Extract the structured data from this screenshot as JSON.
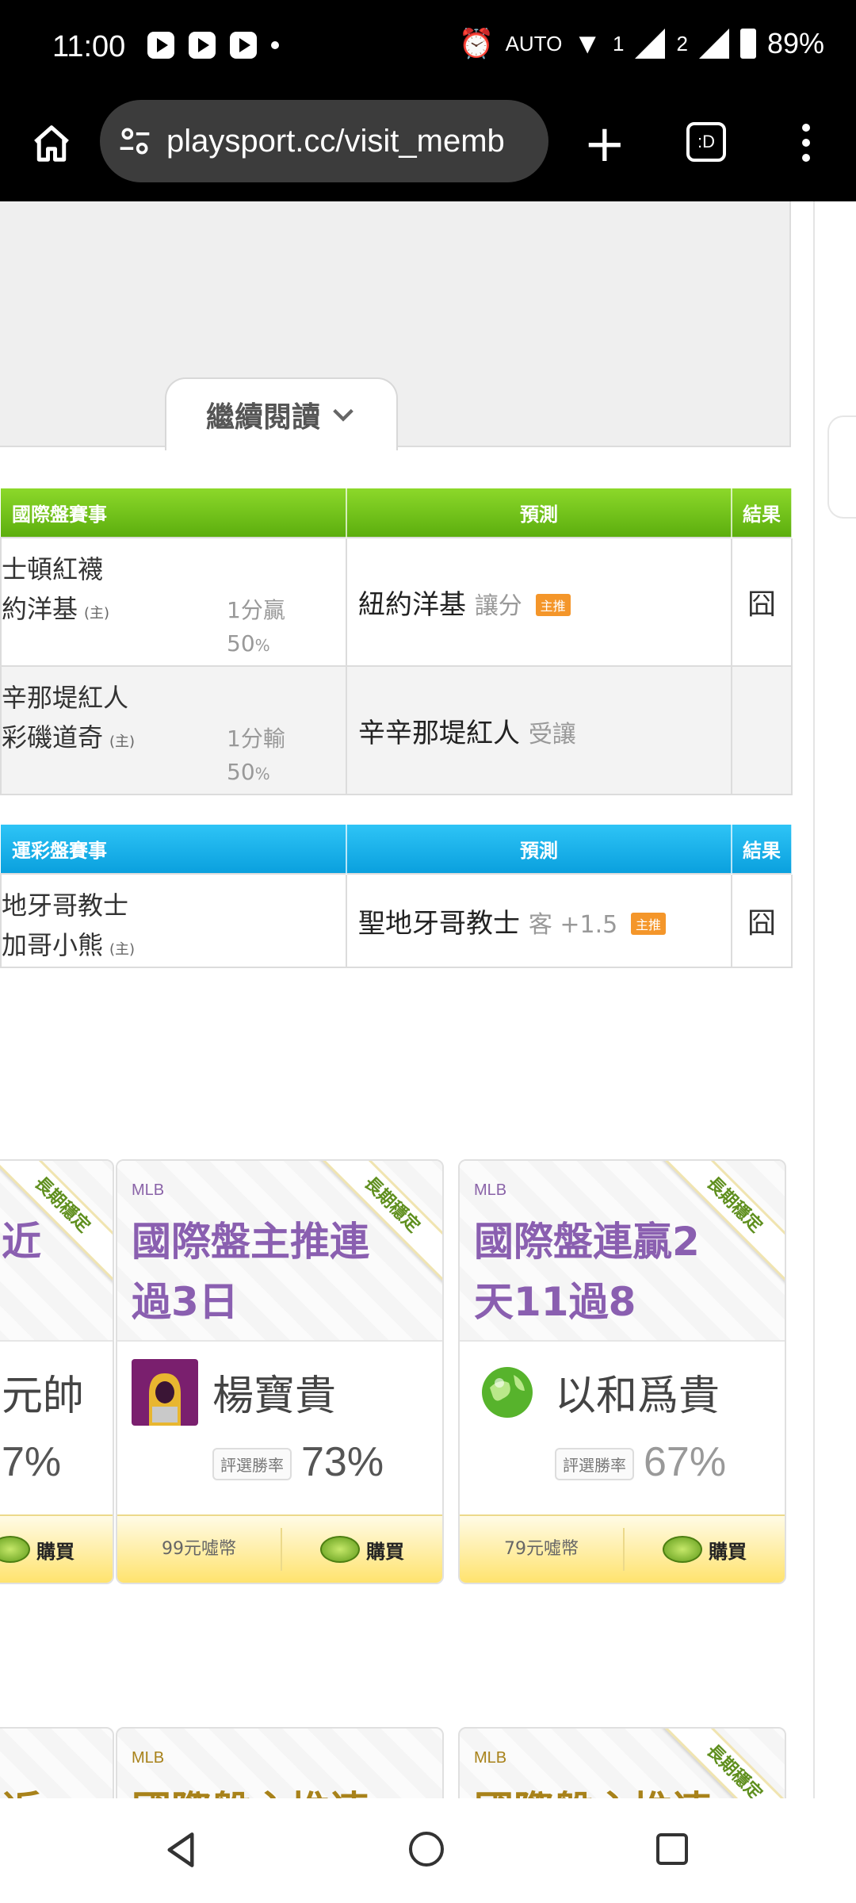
{
  "status_bar": {
    "time": "11:00",
    "battery": "89%",
    "sim1": "1",
    "sim2": "2",
    "auto_label": "AUTO"
  },
  "browser": {
    "url": "playsport.cc/visit_memb",
    "tabs_label": ":D"
  },
  "article": {
    "continue_label": "繼續閱讀"
  },
  "intl_table": {
    "headers": [
      "國際盤賽事",
      "預測",
      "結果"
    ],
    "rows": [
      {
        "away": "士頓紅襪",
        "home": "約洋基",
        "home_mark": "(主)",
        "result_text": "1分贏",
        "percent": "50",
        "percent_unit": "%",
        "pick_team": "紐約洋基",
        "pick_type": "讓分",
        "tag": "主推",
        "outcome": "囧"
      },
      {
        "away": "辛那堤紅人",
        "home": "彩磯道奇",
        "home_mark": "(主)",
        "result_text": "1分輸",
        "percent": "50",
        "percent_unit": "%",
        "pick_team": "辛辛那堤紅人",
        "pick_type": "受讓",
        "outcome": ""
      }
    ]
  },
  "lottery_table": {
    "headers": [
      "運彩盤賽事",
      "預測",
      "結果"
    ],
    "rows": [
      {
        "away": "地牙哥教士",
        "home": "加哥小熊",
        "home_mark": "(主)",
        "pick_team": "聖地牙哥教士",
        "pick_type": "客 +1.5",
        "tag": "主推",
        "outcome": "囧"
      }
    ]
  },
  "cards": [
    {
      "league": "",
      "title": "近",
      "ribbon": "長期穩定",
      "name": "元帥",
      "rate": "7%",
      "buy": "購買"
    },
    {
      "league": "MLB",
      "title": "國際盤主推連過3日",
      "ribbon": "長期穩定",
      "name": "楊寶貴",
      "rate_label": "評選勝率",
      "rate": "73%",
      "price": "99元噓幣",
      "buy": "購買"
    },
    {
      "league": "MLB",
      "title": "國際盤連贏2天11過8",
      "ribbon": "長期穩定",
      "name": "以和爲貴",
      "rate_label": "評選勝率",
      "rate": "67%",
      "price": "79元噓幣",
      "buy": "購買"
    }
  ],
  "cards_row2": [
    {
      "league": "",
      "title": "近"
    },
    {
      "league": "MLB",
      "title": "國際盤主推連"
    },
    {
      "league": "MLB",
      "title": "國際盤主推連",
      "ribbon": "長期穩定"
    }
  ],
  "colors": {
    "green_header": "#6cc01a",
    "blue_header": "#14aee8",
    "card_title": "#8a5fb0",
    "tag_orange": "#f4962a",
    "buy_bar": "#ffe36e"
  }
}
